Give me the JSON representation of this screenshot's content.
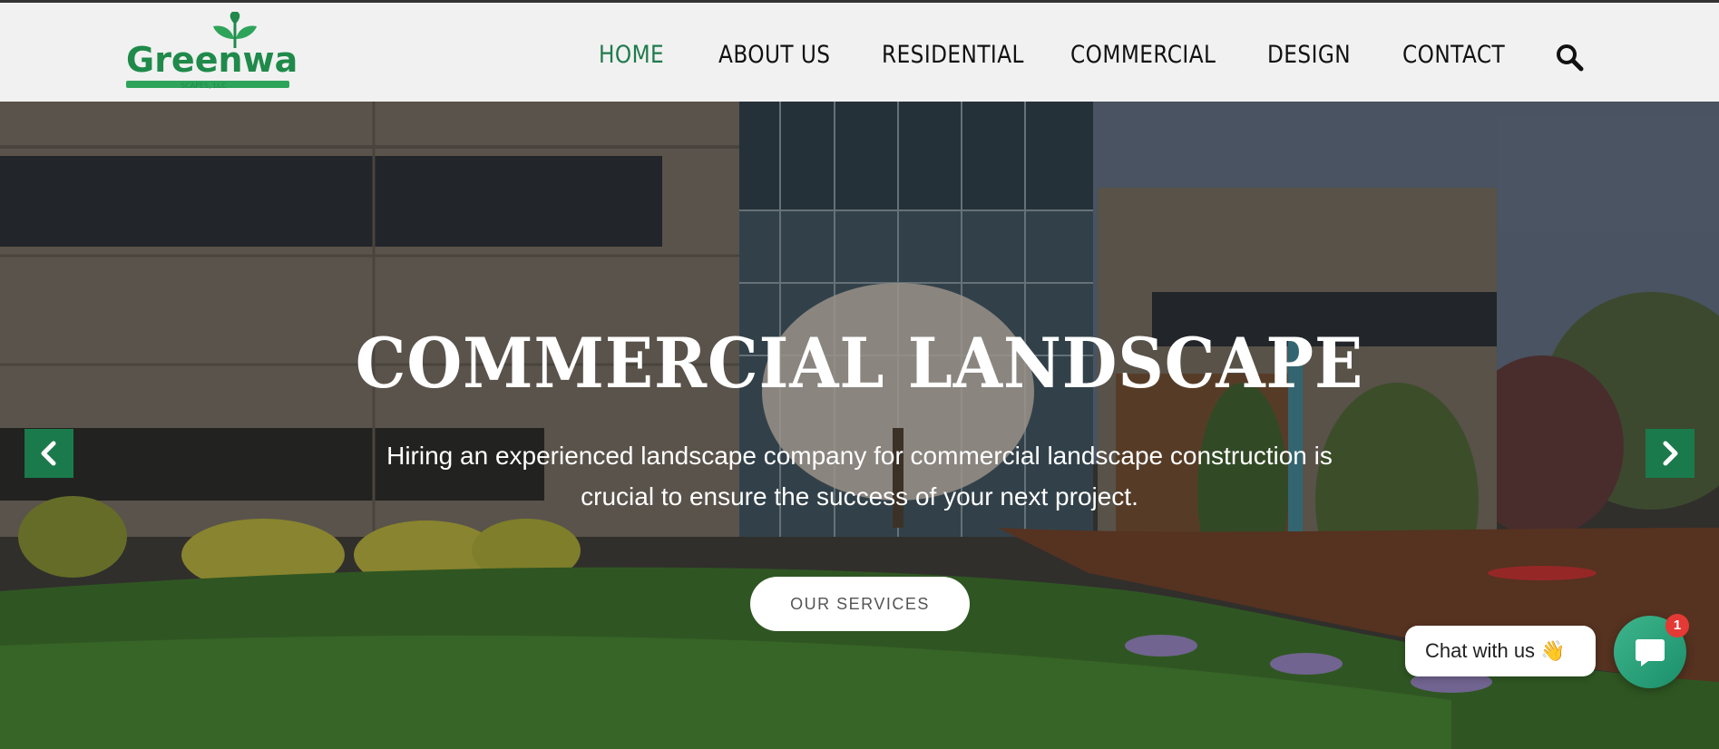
{
  "brand": {
    "logo_text": "Greenway",
    "logo_subtext": "SCAPES, LLC",
    "logo_color": "#1f8a4a"
  },
  "nav": {
    "items": [
      {
        "label": "HOME",
        "active": true
      },
      {
        "label": "ABOUT US",
        "active": false
      },
      {
        "label": "RESIDENTIAL",
        "active": false
      },
      {
        "label": "COMMERCIAL",
        "active": false
      },
      {
        "label": "DESIGN",
        "active": false
      },
      {
        "label": "CONTACT",
        "active": false
      }
    ],
    "search_icon": "search-icon",
    "active_color": "#1f7a4d"
  },
  "hero": {
    "title": "COMMERCIAL LANDSCAPE",
    "subtitle": "Hiring an experienced landscape company for commercial landscape construction is crucial to ensure the success of your next project.",
    "cta_label": "OUR SERVICES",
    "prev_icon": "chevron-left-icon",
    "next_icon": "chevron-right-icon",
    "arrow_color": "#1a7a4c"
  },
  "chat": {
    "label": "Chat with us",
    "emoji": "👋",
    "unread_count": "1",
    "icon": "chat-icon"
  }
}
